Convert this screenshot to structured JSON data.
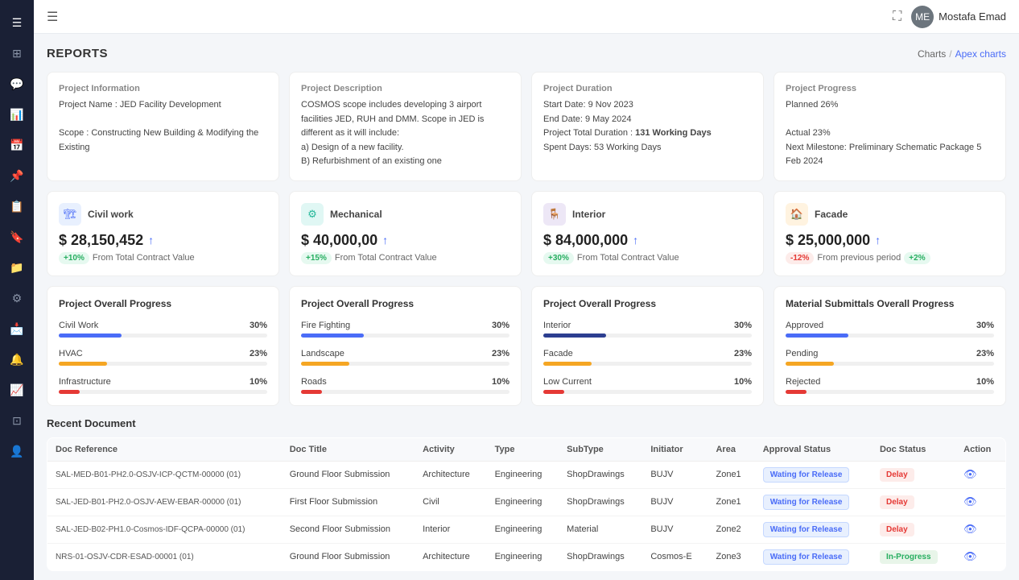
{
  "topbar": {
    "hamburger_label": "☰",
    "fullscreen": "⛶",
    "user_name": "Mostafa Emad",
    "user_initials": "ME"
  },
  "page": {
    "title": "REPORTS",
    "breadcrumb_home": "Charts",
    "breadcrumb_current": "Apex charts"
  },
  "info_cards": [
    {
      "label": "Project Information",
      "lines": [
        "Project Name : JED Facility Development",
        "",
        "Scope : Constructing New Building & Modifying the Existing"
      ]
    },
    {
      "label": "Project Description",
      "lines": [
        "COSMOS scope includes developing 3 airport facilities JED,",
        "RUH and DMM. Scope in JED is different as it will include:",
        "a) Design of a new facility.",
        "B) Refurbishment of an existing one"
      ]
    },
    {
      "label": "Project Duration",
      "lines": [
        "Start Date: 9 Nov 2023",
        "End Date: 9 May 2024",
        "Project Total Duration : 131 Working Days",
        "Spent Days: 53 Working Days"
      ],
      "bold": "131 Working Days"
    },
    {
      "label": "Project Progress",
      "lines": [
        "Planned 26%",
        "",
        "Actual 23%",
        "Next Milestone: Preliminary Schematic Package 5 Feb 2024"
      ]
    }
  ],
  "metric_cards": [
    {
      "icon": "🏗",
      "icon_class": "blue",
      "name": "Civil work",
      "amount": "$ 28,150,452",
      "badge": "+10%",
      "badge_class": "badge-green",
      "sub": "From Total Contract Value"
    },
    {
      "icon": "⚙",
      "icon_class": "teal",
      "name": "Mechanical",
      "amount": "$ 40,000,00",
      "badge": "+15%",
      "badge_class": "badge-green",
      "sub": "From Total Contract Value"
    },
    {
      "icon": "🪑",
      "icon_class": "indigo",
      "name": "Interior",
      "amount": "$ 84,000,000",
      "badge": "+30%",
      "badge_class": "badge-green",
      "sub": "From Total Contract Value"
    },
    {
      "icon": "🏠",
      "icon_class": "orange",
      "name": "Facade",
      "amount": "$ 25,000,000",
      "badge": "-12%",
      "badge_class": "badge-red",
      "sub": "From previous period",
      "extra_badge": "+2%",
      "extra_badge_class": "badge-green"
    }
  ],
  "progress_sections": [
    {
      "title": "Project Overall Progress",
      "items": [
        {
          "name": "Civil Work",
          "pct": "30%",
          "fill": 30,
          "color": "bar-blue"
        },
        {
          "name": "HVAC",
          "pct": "23%",
          "fill": 23,
          "color": "bar-yellow"
        },
        {
          "name": "Infrastructure",
          "pct": "10%",
          "fill": 10,
          "color": "bar-red"
        }
      ]
    },
    {
      "title": "Project Overall Progress",
      "items": [
        {
          "name": "Fire Fighting",
          "pct": "30%",
          "fill": 30,
          "color": "bar-blue"
        },
        {
          "name": "Landscape",
          "pct": "23%",
          "fill": 23,
          "color": "bar-yellow"
        },
        {
          "name": "Roads",
          "pct": "10%",
          "fill": 10,
          "color": "bar-red"
        }
      ]
    },
    {
      "title": "Project Overall Progress",
      "items": [
        {
          "name": "Interior",
          "pct": "30%",
          "fill": 30,
          "color": "bar-dark-blue"
        },
        {
          "name": "Facade",
          "pct": "23%",
          "fill": 23,
          "color": "bar-yellow"
        },
        {
          "name": "Low Current",
          "pct": "10%",
          "fill": 10,
          "color": "bar-red"
        }
      ]
    },
    {
      "title": "Material Submittals Overall Progress",
      "items": [
        {
          "name": "Approved",
          "pct": "30%",
          "fill": 30,
          "color": "bar-blue"
        },
        {
          "name": "Pending",
          "pct": "23%",
          "fill": 23,
          "color": "bar-yellow"
        },
        {
          "name": "Rejected",
          "pct": "10%",
          "fill": 10,
          "color": "bar-red"
        }
      ]
    }
  ],
  "recent_doc": {
    "title": "Recent Document",
    "columns": [
      "Doc Reference",
      "Doc Title",
      "Activity",
      "Type",
      "SubType",
      "Initiator",
      "Area",
      "Approval Status",
      "Doc Status",
      "Action"
    ],
    "rows": [
      {
        "ref": "SAL-MED-B01-PH2.0-OSJV-ICP-QCTM-00000 (01)",
        "title": "Ground Floor Submission",
        "activity": "Architecture",
        "type": "Engineering",
        "subtype": "ShopDrawings",
        "initiator": "BUJV",
        "area": "Zone1",
        "approval": "Wating for Release",
        "status": "Delay",
        "status_class": "status-delay"
      },
      {
        "ref": "SAL-JED-B01-PH2.0-OSJV-AEW-EBAR-00000 (01)",
        "title": "First Floor Submission",
        "activity": "Civil",
        "type": "Engineering",
        "subtype": "ShopDrawings",
        "initiator": "BUJV",
        "area": "Zone1",
        "approval": "Wating for Release",
        "status": "Delay",
        "status_class": "status-delay"
      },
      {
        "ref": "SAL-JED-B02-PH1.0-Cosmos-IDF-QCPA-00000 (01)",
        "title": "Second Floor Submission",
        "activity": "Interior",
        "type": "Engineering",
        "subtype": "Material",
        "initiator": "BUJV",
        "area": "Zone2",
        "approval": "Wating for Release",
        "status": "Delay",
        "status_class": "status-delay"
      },
      {
        "ref": "NRS-01-OSJV-CDR-ESAD-00001 (01)",
        "title": "Ground Floor Submission",
        "activity": "Architecture",
        "type": "Engineering",
        "subtype": "ShopDrawings",
        "initiator": "Cosmos-E",
        "area": "Zone3",
        "approval": "Wating for Release",
        "status": "In-Progress",
        "status_class": "status-inprogress"
      }
    ]
  },
  "sidebar_icons": [
    "☰",
    "⊞",
    "💬",
    "📊",
    "📅",
    "📌",
    "📋",
    "🔖",
    "📁",
    "⚙",
    "📩",
    "🔔",
    "📈",
    "⊡",
    "👤"
  ]
}
